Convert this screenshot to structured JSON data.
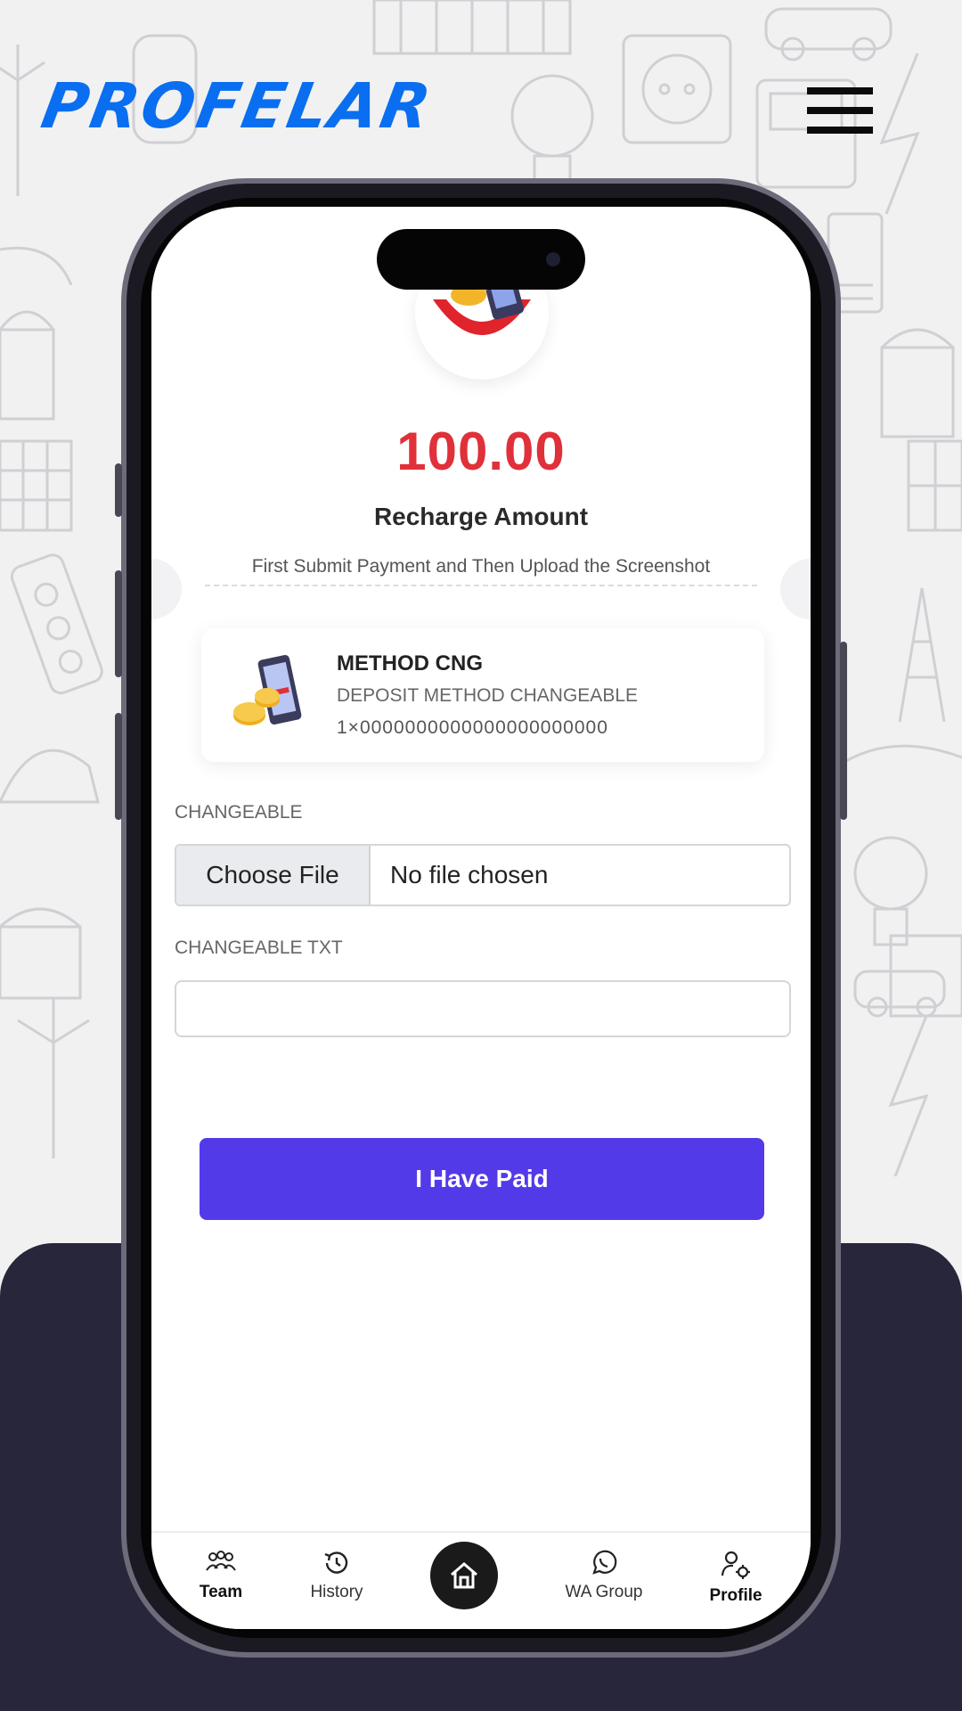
{
  "app": {
    "brand": "PROFELAR",
    "brand_color": "#0a6ef0",
    "menu_icon": "hamburger-menu-icon"
  },
  "recharge": {
    "amount": "100.00",
    "amount_label": "Recharge Amount",
    "instruction": "First Submit Payment and Then Upload the Screenshot",
    "amount_color": "#e0303a"
  },
  "method": {
    "name": "METHOD CNG",
    "description": "DEPOSIT METHOD CHANGEABLE",
    "account": "1×0000000000000000000000",
    "icon": "phone-coins-icon"
  },
  "form": {
    "file_label": "CHANGEABLE",
    "file_button": "Choose File",
    "file_status": "No file chosen",
    "text_label": "CHANGEABLE TXT",
    "text_value": "",
    "submit_label": "I Have Paid",
    "submit_color": "#533ae9"
  },
  "tabbar": {
    "items": [
      {
        "label": "Team",
        "icon": "team-icon"
      },
      {
        "label": "History",
        "icon": "history-icon"
      },
      {
        "label": "",
        "icon": "home-icon"
      },
      {
        "label": "WA Group",
        "icon": "whatsapp-icon"
      },
      {
        "label": "Profile",
        "icon": "profile-settings-icon"
      }
    ]
  }
}
